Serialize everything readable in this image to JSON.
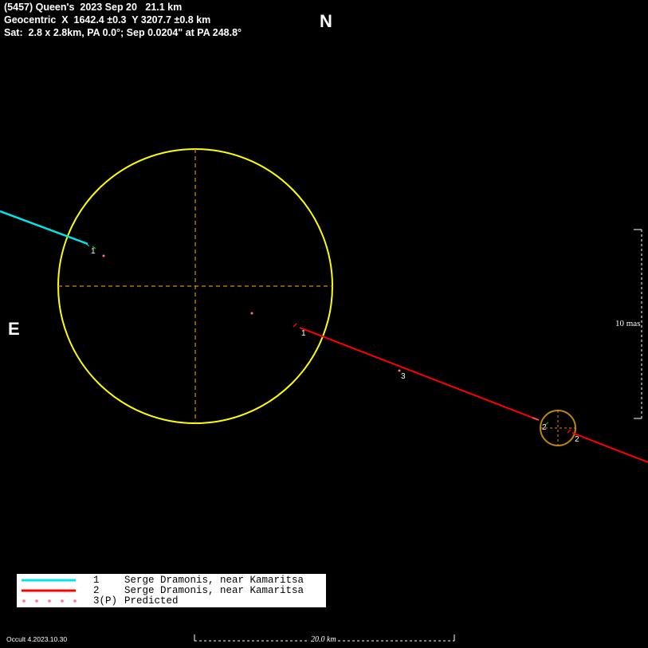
{
  "header": {
    "line1": "(5457) Queen's  2023 Sep 20   21.1 km",
    "line2": "Geocentric  X  1642.4 ±0.3  Y 3207.7 ±0.8 km",
    "line3": "Sat:  2.8 x 2.8km, PA 0.0°; Sep 0.0204\" at PA 248.8°"
  },
  "compass": {
    "north": "N",
    "east": "E"
  },
  "colors": {
    "primary_ellipse": "#ffff00",
    "satellite_ellipse": "#b8860b",
    "axis_dash": "#e08a00",
    "chord1": "#00e5ee",
    "chord2": "#ff0000",
    "predicted": "#ff6f8f"
  },
  "chord_labels": {
    "chord1_primary": "1",
    "chord2_primary": "1",
    "predicted_marker": "3",
    "chord2_satellite_a": "2",
    "chord2_satellite_b": "2"
  },
  "legend": [
    {
      "number": "1",
      "name": "Serge Dramonis, near Kamaritsa",
      "style": "cyan-line"
    },
    {
      "number": "2",
      "name": "Serge Dramonis, near Kamaritsa",
      "style": "red-line"
    },
    {
      "number": "3(P)",
      "name": "Predicted",
      "style": "pink-dots"
    }
  ],
  "scale_bar": {
    "label": "20.0 km"
  },
  "angular_scale": {
    "label": "10 mas"
  },
  "footer": {
    "version": "Occult 4.2023.10.30"
  }
}
